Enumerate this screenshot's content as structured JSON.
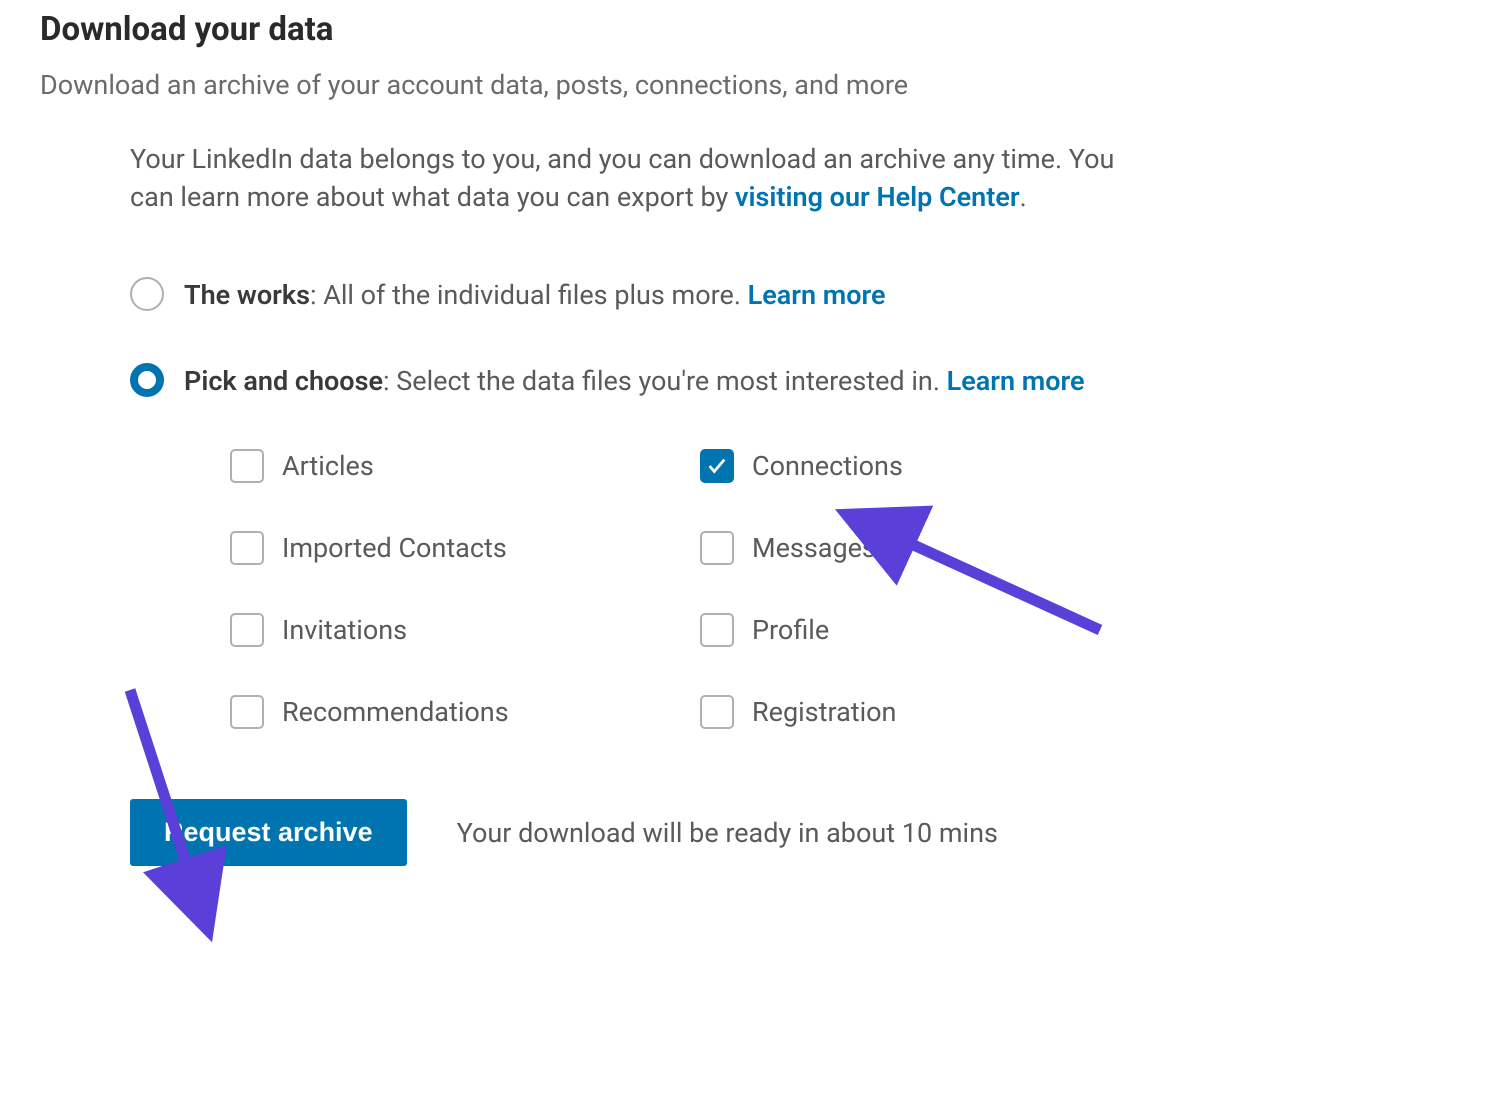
{
  "page": {
    "title": "Download your data",
    "subtitle": "Download an archive of your account data, posts, connections, and more"
  },
  "intro": {
    "text_before_link": "Your LinkedIn data belongs to you, and you can download an archive any time. You can learn more about what data you can export by ",
    "link_text": "visiting our Help Center",
    "text_after_link": "."
  },
  "options": {
    "works": {
      "bold": "The works",
      "desc": ": All of the individual files plus more. ",
      "learn_more": "Learn more",
      "selected": false
    },
    "pick": {
      "bold": "Pick and choose",
      "desc": ": Select the data files you're most interested in. ",
      "learn_more": "Learn more",
      "selected": true
    }
  },
  "checkboxes": [
    {
      "id": "articles",
      "label": "Articles",
      "checked": false
    },
    {
      "id": "connections",
      "label": "Connections",
      "checked": true
    },
    {
      "id": "imported-contacts",
      "label": "Imported Contacts",
      "checked": false
    },
    {
      "id": "messages",
      "label": "Messages",
      "checked": false
    },
    {
      "id": "invitations",
      "label": "Invitations",
      "checked": false
    },
    {
      "id": "profile",
      "label": "Profile",
      "checked": false
    },
    {
      "id": "recommendations",
      "label": "Recommendations",
      "checked": false
    },
    {
      "id": "registration",
      "label": "Registration",
      "checked": false
    }
  ],
  "action": {
    "button_label": "Request archive",
    "note": "Your download will be ready in about 10 mins"
  },
  "colors": {
    "link": "#0073b1",
    "primary_button": "#0073b1",
    "annotation_arrow": "#5a3fd8"
  }
}
